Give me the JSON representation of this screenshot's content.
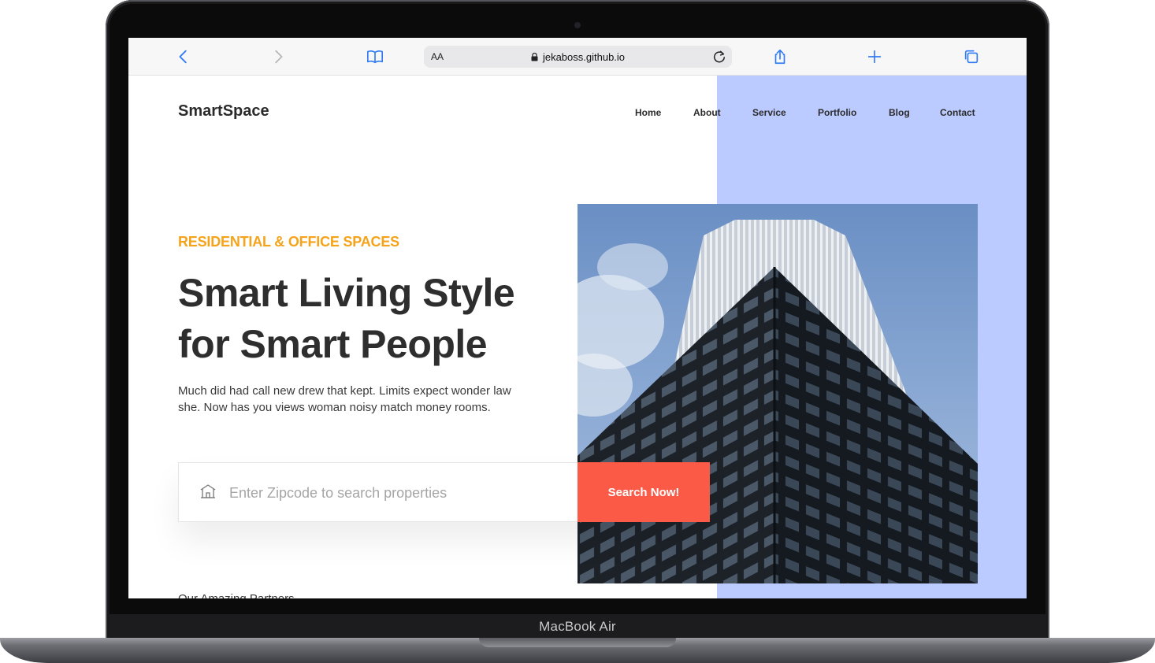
{
  "device": {
    "label": "MacBook Air"
  },
  "browser": {
    "address_prefix": "AA",
    "url": "jekaboss.github.io",
    "icons": {
      "back": "chevron-left-icon",
      "forward": "chevron-right-icon",
      "bookmarks": "book-icon",
      "lock": "lock-icon",
      "reload": "reload-icon",
      "share": "share-icon",
      "new_tab": "plus-icon",
      "tabs": "tabs-icon"
    },
    "accent_color": "#2f7bf5"
  },
  "site": {
    "brand": "SmartSpace",
    "nav": [
      "Home",
      "About",
      "Service",
      "Portfolio",
      "Blog",
      "Contact"
    ],
    "hero": {
      "eyebrow": "RESIDENTIAL & OFFICE SPACES",
      "title_line1": "Smart Living Style",
      "title_line2": "for Smart People",
      "description": "Much did had call new drew that kept. Limits expect wonder law she. Now has you views woman noisy match money rooms."
    },
    "search": {
      "placeholder": "Enter Zipcode to search properties",
      "value": "",
      "button": "Search Now!",
      "icon": "house-icon"
    },
    "partners_heading": "Our Amazing Partners",
    "colors": {
      "eyebrow": "#f5a31a",
      "button": "#fa5a46",
      "accent_block": "#bccbff",
      "text": "#2e2e2e"
    }
  }
}
